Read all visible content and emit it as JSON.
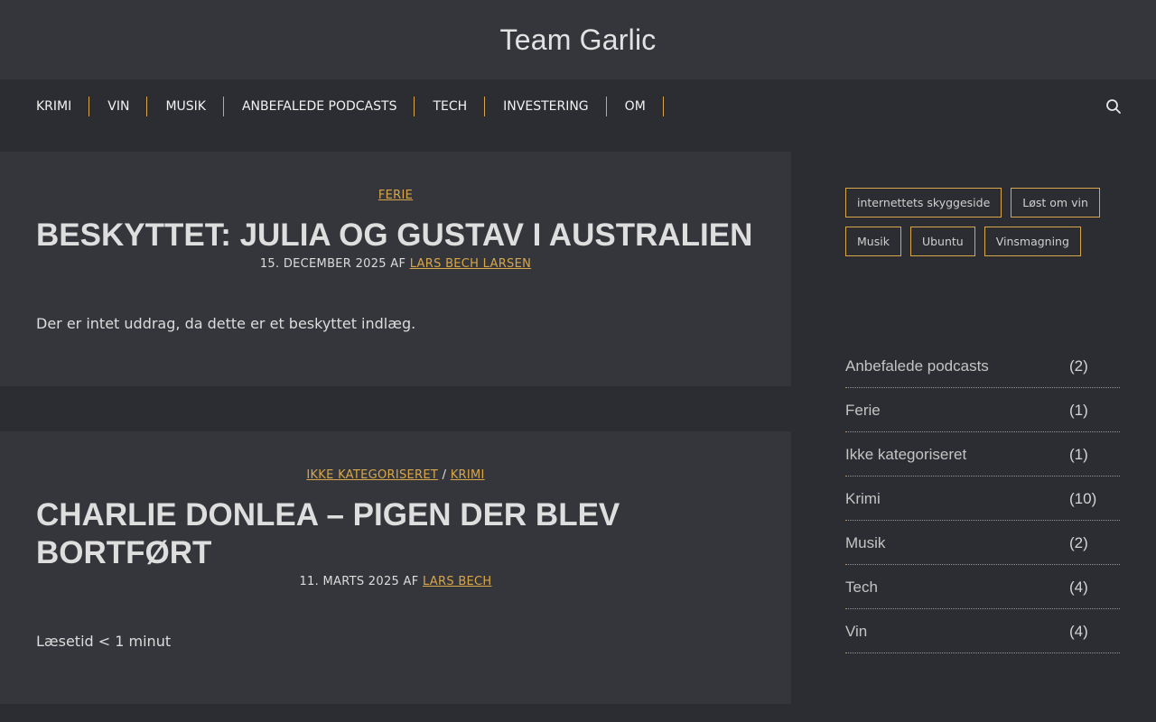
{
  "site": {
    "title": "Team Garlic"
  },
  "nav": {
    "items": [
      "KRIMI",
      "VIN",
      "MUSIK",
      "ANBEFALEDE PODCASTS",
      "TECH",
      "INVESTERING",
      "OM"
    ],
    "search_icon": "search-icon"
  },
  "posts": [
    {
      "categories": [
        "FERIE"
      ],
      "title": "BESKYTTET: JULIA OG GUSTAV I AUSTRALIEN",
      "date": "15. DECEMBER 2025",
      "by": "AF",
      "author": "LARS BECH LARSEN",
      "excerpt": "Der er intet uddrag, da dette er et beskyttet indlæg."
    },
    {
      "categories": [
        "IKKE KATEGORISERET",
        "KRIMI"
      ],
      "category_separator": "/",
      "title": "CHARLIE DONLEA – PIGEN DER BLEV BORTFØRT",
      "date": "11. MARTS 2025",
      "by": "AF",
      "author": "LARS BECH",
      "excerpt": "Læsetid < 1 minut"
    }
  ],
  "sidebar": {
    "tags": [
      "internettets skyggeside",
      "Løst om vin",
      "Musik",
      "Ubuntu",
      "Vinsmagning"
    ],
    "categories": [
      {
        "name": "Anbefalede podcasts",
        "count": "(2)"
      },
      {
        "name": "Ferie",
        "count": "(1)"
      },
      {
        "name": "Ikke kategoriseret",
        "count": "(1)"
      },
      {
        "name": "Krimi",
        "count": "(10)"
      },
      {
        "name": "Musik",
        "count": "(2)"
      },
      {
        "name": "Tech",
        "count": "(4)"
      },
      {
        "name": "Vin",
        "count": "(4)"
      }
    ]
  },
  "colors": {
    "accent": "#d8a64b",
    "background": "#2c2d32",
    "panel": "#35363b"
  }
}
